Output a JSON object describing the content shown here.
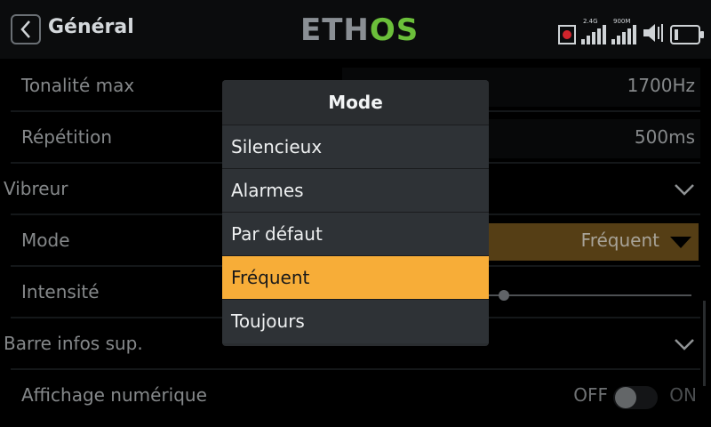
{
  "header": {
    "title": "Général",
    "logo_left": "ETH",
    "logo_right": "OS",
    "signal_24": "2.4G",
    "signal_900": "900M"
  },
  "rows": {
    "tonalite": {
      "label": "Tonalité max",
      "value": "1700Hz"
    },
    "repetition": {
      "label": "Répétition",
      "value": "500ms"
    },
    "vibreur": {
      "label": "Vibreur"
    },
    "mode": {
      "label": "Mode",
      "value": "Fréquent"
    },
    "intensite": {
      "label": "Intensité",
      "level": 0.02
    },
    "barre": {
      "label": "Barre infos sup."
    },
    "affichage": {
      "label": "Affichage numérique",
      "off": "OFF",
      "on": "ON",
      "state": "off"
    }
  },
  "dialog": {
    "title": "Mode",
    "options": [
      "Silencieux",
      "Alarmes",
      "Par défaut",
      "Fréquent",
      "Toujours"
    ],
    "selected": "Fréquent"
  },
  "colors": {
    "accent": "#f7ad38",
    "brand_green": "#6bbf3a",
    "select_bg": "#7a5a1f"
  }
}
